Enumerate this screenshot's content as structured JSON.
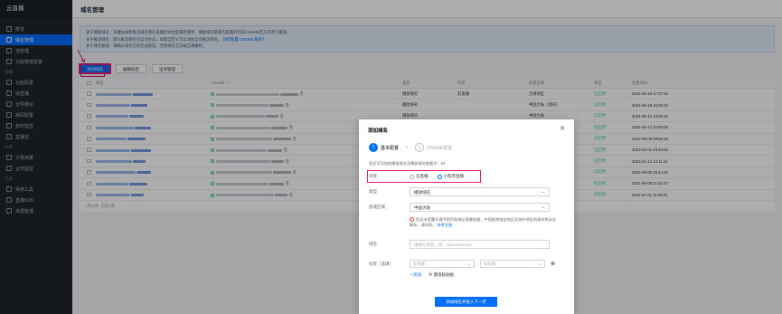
{
  "app": {
    "title": "云直播"
  },
  "sidebar": {
    "items": [
      {
        "label": "概览",
        "icon": "dashboard-icon"
      },
      {
        "label": "域名管理",
        "icon": "globe-icon",
        "active": true
      },
      {
        "label": "流管理",
        "icon": "stream-icon"
      },
      {
        "label": "功能模板配置",
        "icon": "template-icon"
      }
    ],
    "groups": [
      {
        "label": "直播",
        "items": [
          "功能配置",
          "快直播",
          "云导播台",
          "转码配置",
          "实时监控",
          "直播宝"
        ]
      },
      {
        "label": "计费",
        "items": [
          "计费用量",
          "业务监控"
        ]
      },
      {
        "label": "工具",
        "items": [
          "常用工具",
          "直播SDK",
          "资源管理"
        ]
      }
    ]
  },
  "page": {
    "title": "域名管理",
    "notice_lines": [
      "关于播放域名：直播加速和推流域名需在直播控制台配置后使用，播放域名需要先配置并完成CNAME后方可进行播放。",
      "关于推流域名：默认推流域名已自动生成，如需自定义可以添加自有推流域名。",
      "关于域名备案：请确认域名已经完成备案，否则域名无法被正确解析。"
    ],
    "notice_link": "如何配置 CNAME 解析？"
  },
  "toolbar": {
    "add_domain": "添加域名",
    "batch": "编辑标签",
    "cert": "证书管理"
  },
  "table": {
    "headers": [
      "域名",
      "CNAME ⓘ",
      "类型",
      "场景",
      "加速区域",
      "状态",
      "创建时间"
    ],
    "rows": [
      {
        "type": "播放域名",
        "scene": "云直播",
        "region": "全球地区",
        "status": "已启用",
        "time": "2024-06-18 17:37:20"
      },
      {
        "type": "播放域名",
        "scene": "",
        "region": "中国大陆（境内）",
        "status": "已启用",
        "time": "2024-06-18 16:05:10"
      },
      {
        "type": "播放域名",
        "scene": "",
        "region": "中国大陆",
        "status": "已启用",
        "time": "2024-06-12 18:08:28"
      },
      {
        "type": "播放域名",
        "scene": "",
        "region": "中国大陆（境内）",
        "status": "已启用",
        "time": "2024-06-12 15:55:08"
      },
      {
        "type": "播放域名",
        "scene": "",
        "region": "中国大陆",
        "status": "已启用",
        "time": "2023-08-09 09:59:19"
      },
      {
        "type": "播放域名",
        "scene": "",
        "region": "中国大陆",
        "status": "已启用",
        "time": "2023-02-01 23:20:00"
      },
      {
        "type": "播放域名",
        "scene": "",
        "region": "中国大陆（境内）",
        "status": "已启用",
        "time": "2023-01-12 12:11:44"
      },
      {
        "type": "推流域名",
        "scene": "",
        "region": "中国大陆（境内）",
        "status": "已启用",
        "time": "2022-09-08 15:44:23"
      },
      {
        "type": "播放域名",
        "scene": "",
        "region": "中国大陆（境内）",
        "status": "已启用",
        "time": "2022-08-08 11:42:47"
      },
      {
        "type": "推流域名",
        "scene": "",
        "region": "中国大陆（境内）",
        "status": "已启用",
        "time": "2022-07-01 11:08:01"
      }
    ],
    "footer": "共10条",
    "footer_extra": "已选0条"
  },
  "modal": {
    "title": "添加域名",
    "close_icon": "close-icon",
    "step1": {
      "num": "1",
      "label": "基本配置"
    },
    "step2": {
      "num": "2",
      "label": "CNAME配置"
    },
    "quota": "您还可添加的播放域名及播放域名数量为：94",
    "scene_label": "场景",
    "scene_options": [
      "云直播",
      "小程序直播"
    ],
    "scene_selected": "小程序直播",
    "type_label": "类型",
    "type_value": "播放域名",
    "region_label": "加速区域",
    "region_value": "中国大陆",
    "hint": "您还未签署开通中国大陆地区直播加速，中国香港澳台地区及海外地区的请求将无法解析，请知悉。 ",
    "hint_link": "参考文档",
    "domain_label": "域名",
    "domain_placeholder": "请填写域名，如：www.test.com",
    "tag_label": "标签（选填）",
    "tag_key_placeholder": "标签键",
    "tag_value_placeholder": "标签值",
    "tag_add": "+ 添加",
    "tag_existing": "⊕ 键值粘贴板",
    "submit": "添加域名并进入下一步"
  }
}
